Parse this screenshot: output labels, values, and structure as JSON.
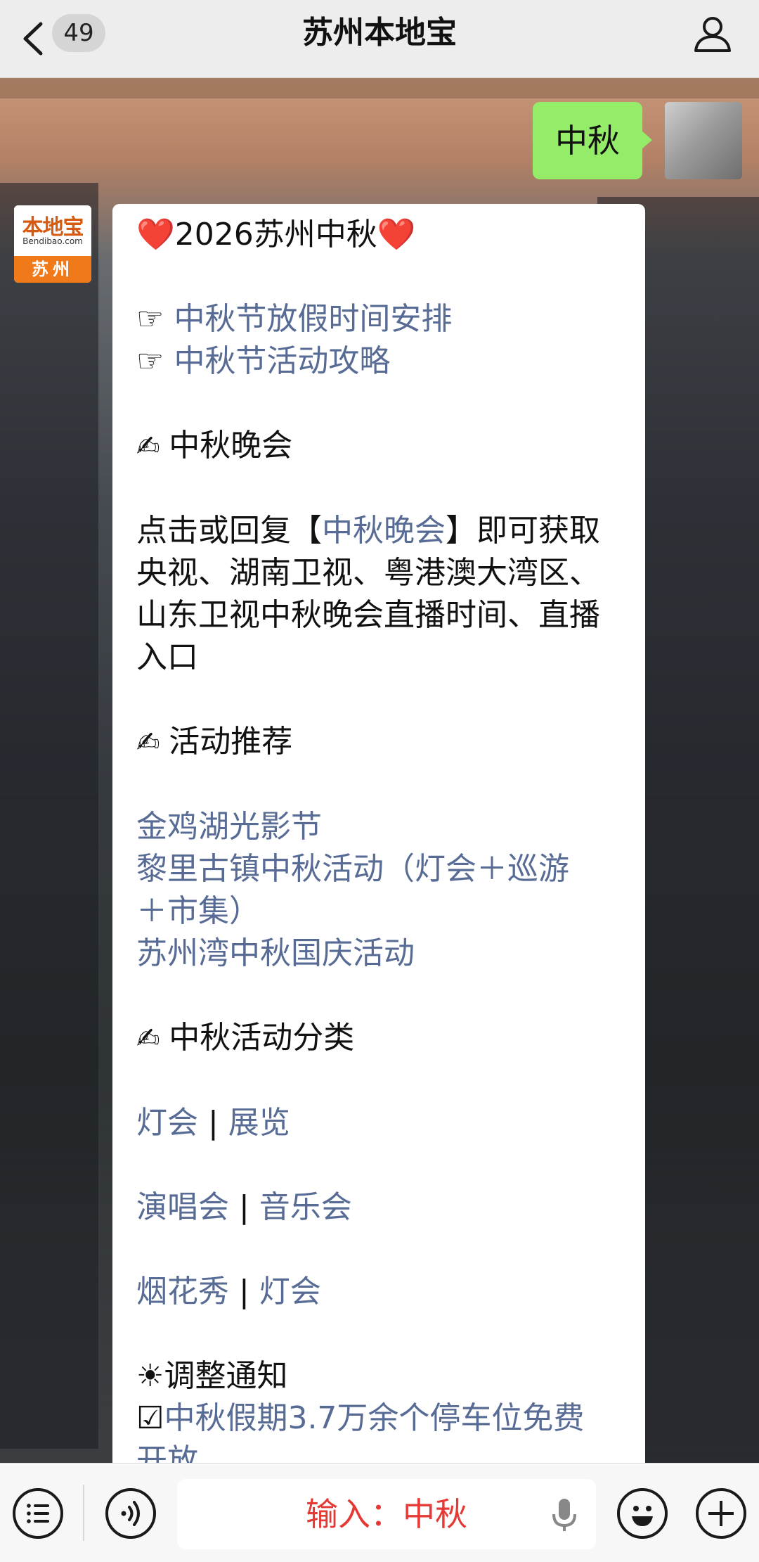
{
  "header": {
    "unread_count": "49",
    "title": "苏州本地宝"
  },
  "chat": {
    "user_message": "中秋",
    "bot_avatar": {
      "logo": "本地宝",
      "domain": "Bendibao.com",
      "city": "苏州"
    },
    "bot_lines": [
      {
        "parts": [
          {
            "t": "❤️",
            "c": "heart"
          },
          {
            "t": "2026苏州中秋"
          },
          {
            "t": "❤️",
            "c": "heart"
          }
        ]
      },
      {
        "gap": true
      },
      {
        "parts": [
          {
            "t": "☞ "
          },
          {
            "t": "中秋节放假时间安排",
            "c": "link"
          }
        ]
      },
      {
        "parts": [
          {
            "t": "☞ "
          },
          {
            "t": "中秋节活动攻略",
            "c": "link"
          }
        ]
      },
      {
        "gap": true
      },
      {
        "parts": [
          {
            "t": "✍ ",
            "c": "hand"
          },
          {
            "t": "中秋晚会"
          }
        ]
      },
      {
        "gap": true
      },
      {
        "parts": [
          {
            "t": "点击或回复【"
          },
          {
            "t": "中秋晚会",
            "c": "link"
          },
          {
            "t": "】即可获取"
          }
        ]
      },
      {
        "parts": [
          {
            "t": "央视、湖南卫视、粤港澳大湾区、"
          }
        ]
      },
      {
        "parts": [
          {
            "t": "山东卫视中秋晚会直播时间、直播"
          }
        ]
      },
      {
        "parts": [
          {
            "t": "入口"
          }
        ]
      },
      {
        "gap": true
      },
      {
        "parts": [
          {
            "t": "✍ ",
            "c": "hand"
          },
          {
            "t": "活动推荐"
          }
        ]
      },
      {
        "gap": true
      },
      {
        "parts": [
          {
            "t": "金鸡湖光影节",
            "c": "link"
          }
        ]
      },
      {
        "parts": [
          {
            "t": "黎里古镇中秋活动（灯会＋巡游",
            "c": "link"
          }
        ]
      },
      {
        "parts": [
          {
            "t": "＋市集）",
            "c": "link"
          }
        ]
      },
      {
        "parts": [
          {
            "t": "苏州湾中秋国庆活动",
            "c": "link"
          }
        ]
      },
      {
        "gap": true
      },
      {
        "parts": [
          {
            "t": "✍ ",
            "c": "hand"
          },
          {
            "t": "中秋活动分类"
          }
        ]
      },
      {
        "gap": true
      },
      {
        "parts": [
          {
            "t": "灯会",
            "c": "link"
          },
          {
            "t": " | "
          },
          {
            "t": "展览",
            "c": "link"
          }
        ]
      },
      {
        "gap": true
      },
      {
        "parts": [
          {
            "t": "演唱会",
            "c": "link"
          },
          {
            "t": " | "
          },
          {
            "t": "音乐会",
            "c": "link"
          }
        ]
      },
      {
        "gap": true
      },
      {
        "parts": [
          {
            "t": "烟花秀",
            "c": "link"
          },
          {
            "t": " | "
          },
          {
            "t": "灯会",
            "c": "link"
          }
        ]
      },
      {
        "gap": true
      },
      {
        "parts": [
          {
            "t": "☀"
          },
          {
            "t": "调整通知"
          }
        ]
      },
      {
        "parts": [
          {
            "t": "☑"
          },
          {
            "t": "中秋假期3.7万余个停车位免费",
            "c": "link"
          }
        ]
      },
      {
        "parts": [
          {
            "t": "开放",
            "c": "link"
          }
        ]
      }
    ]
  },
  "bottom_bar": {
    "input_text": "输入：中秋"
  }
}
